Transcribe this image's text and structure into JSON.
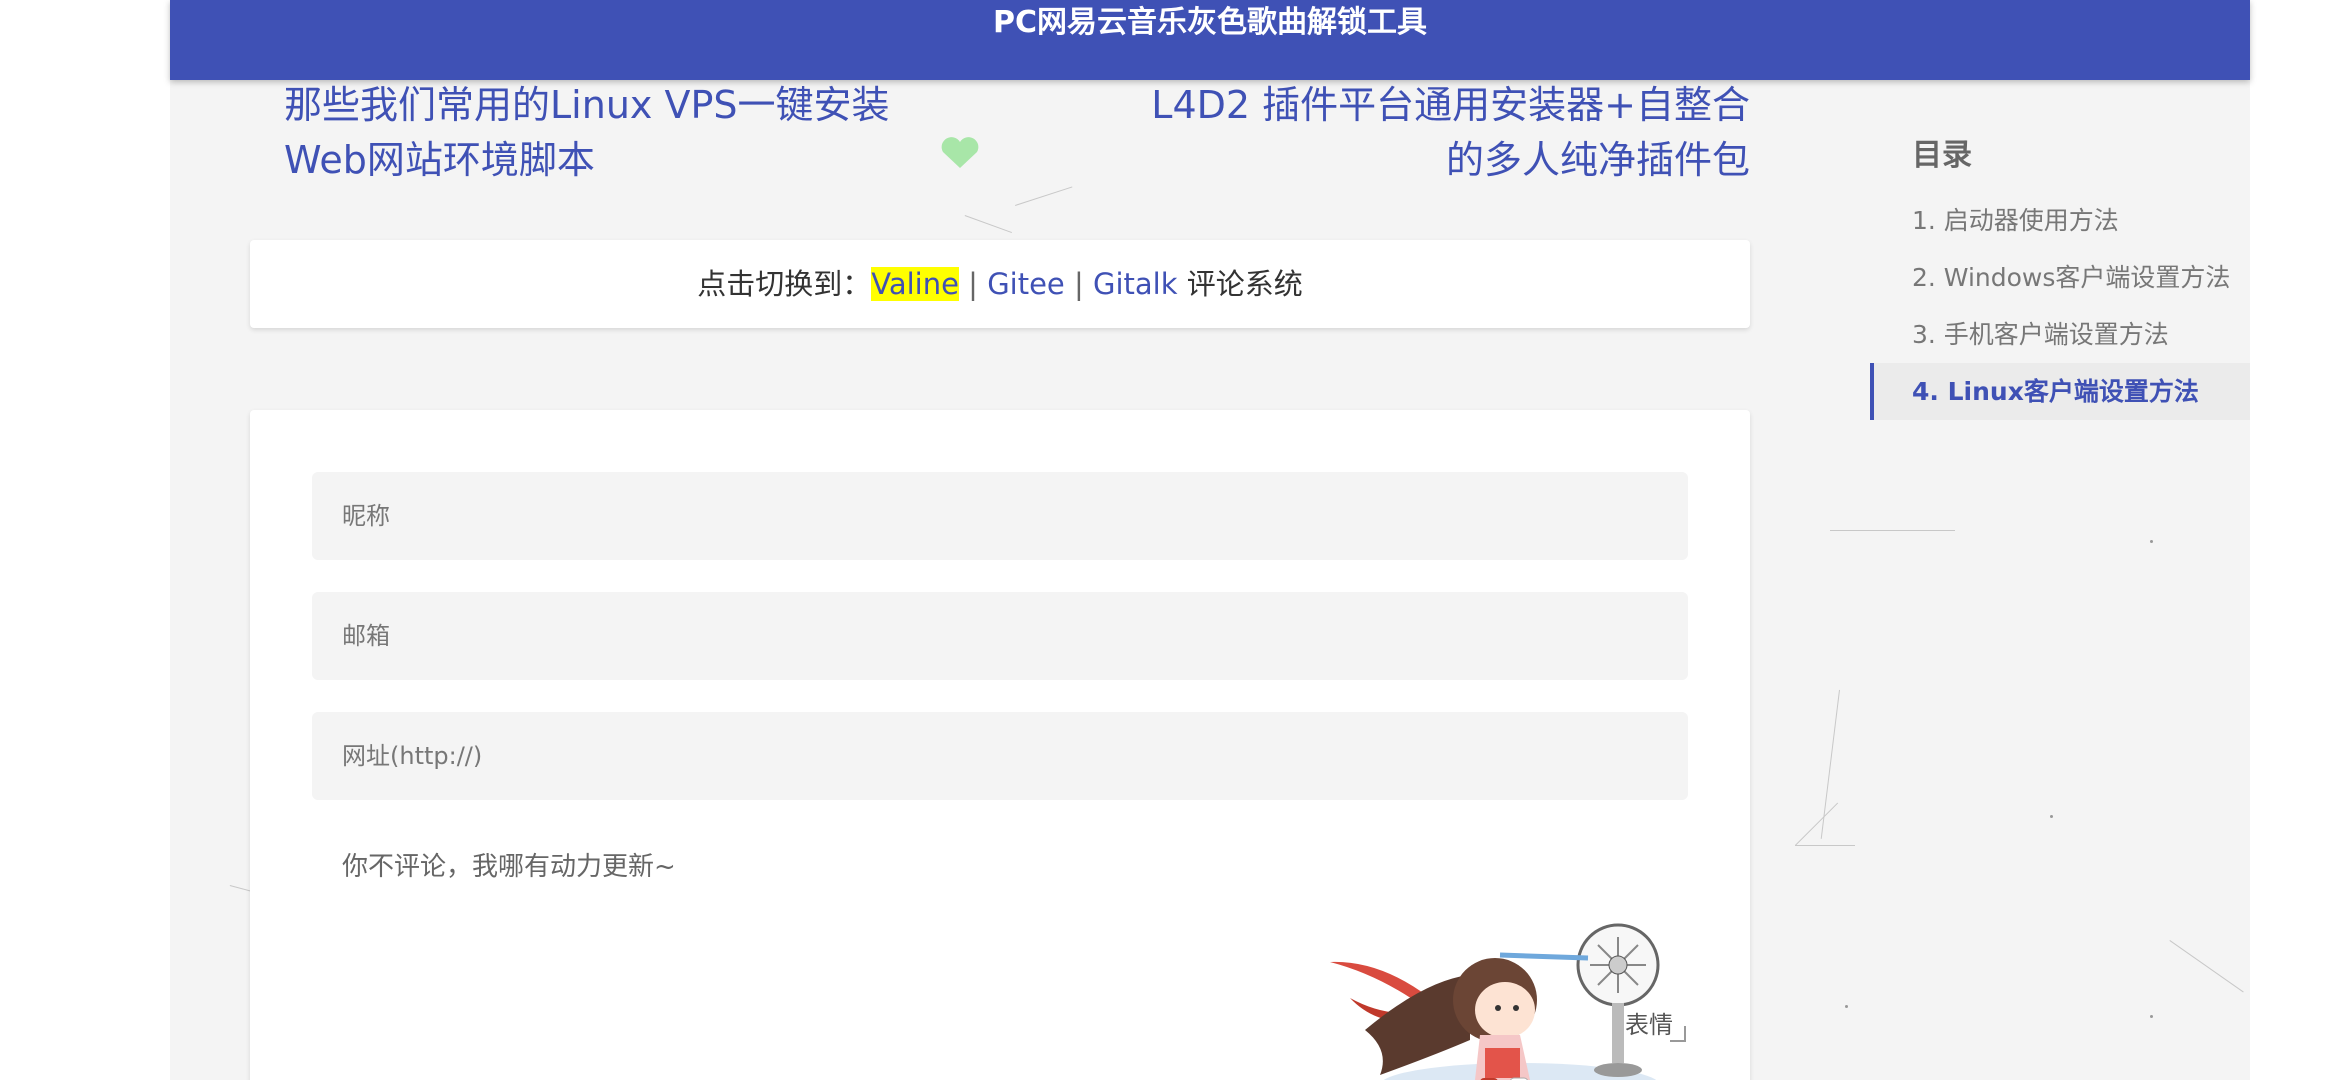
{
  "header": {
    "title": "PC网易云音乐灰色歌曲解锁工具"
  },
  "post_nav": {
    "prev_line1": "那些我们常用的Linux VPS一键安装",
    "prev_line2": "Web网站环境脚本",
    "next_line1": "L4D2 插件平台通用安装器+自整合",
    "next_line2": "的多人纯净插件包"
  },
  "comment_switch": {
    "prefix": "点击切换到：",
    "valine": "Valine",
    "sep1": " | ",
    "gitee": "Gitee",
    "sep2": " | ",
    "gitalk": "Gitalk",
    "suffix": " 评论系统"
  },
  "comment_form": {
    "nick_placeholder": "昵称",
    "mail_placeholder": "邮箱",
    "link_placeholder": "网址(http://)",
    "content_placeholder": "你不评论，我哪有动力更新~",
    "emoji_label": "表情"
  },
  "toc": {
    "title": "目录",
    "items": [
      {
        "label": "1. 启动器使用方法"
      },
      {
        "label": "2. Windows客户端设置方法"
      },
      {
        "label": "3. 手机客户端设置方法"
      },
      {
        "label": "4. Linux客户端设置方法"
      }
    ],
    "active_index": 3
  },
  "colors": {
    "primary": "#3f51b5",
    "highlight": "#ffff00"
  }
}
